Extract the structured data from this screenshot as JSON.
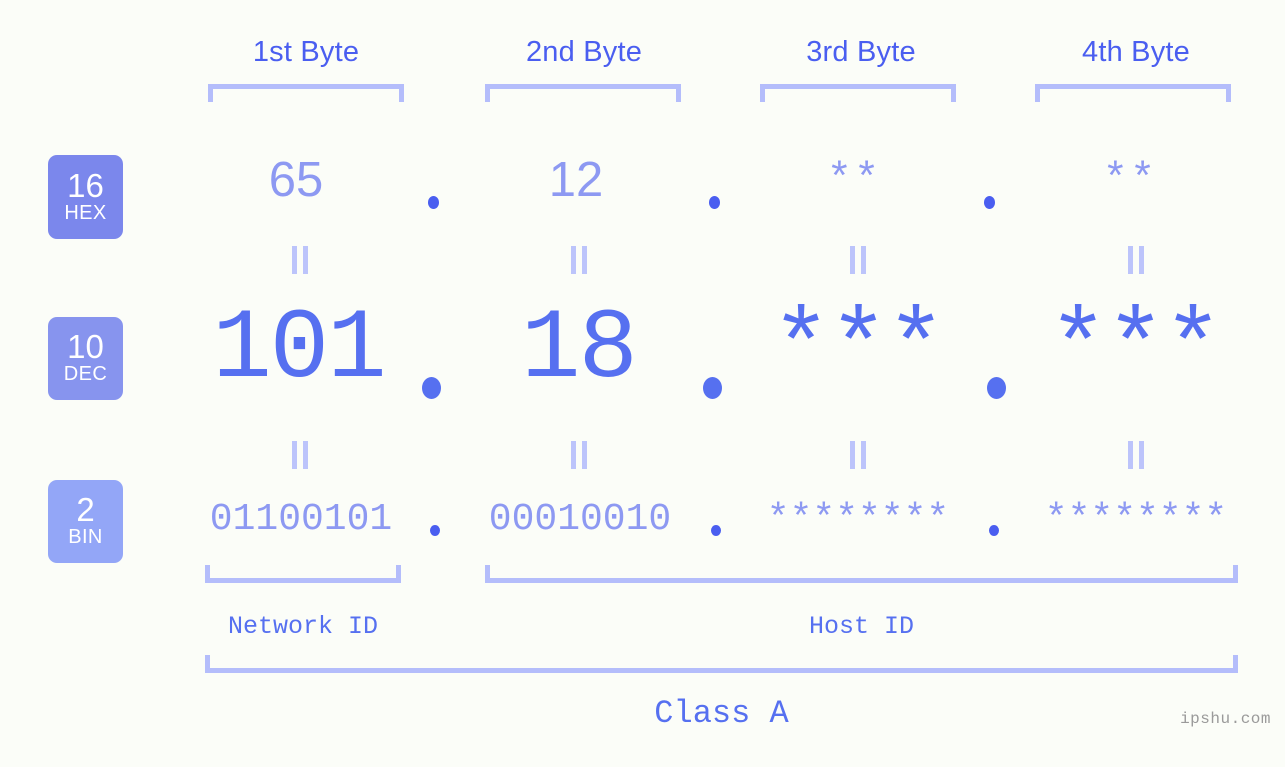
{
  "site": {
    "watermark": "ipshu.com"
  },
  "byte_headers": [
    {
      "label": "1st Byte"
    },
    {
      "label": "2nd Byte"
    },
    {
      "label": "3rd Byte"
    },
    {
      "label": "4th Byte"
    }
  ],
  "bases": [
    {
      "radix": "16",
      "name": "HEX",
      "color": "#7b87ec"
    },
    {
      "radix": "10",
      "name": "DEC",
      "color": "#8794ee"
    },
    {
      "radix": "2",
      "name": "BIN",
      "color": "#93a6f7"
    }
  ],
  "rows": {
    "hex": {
      "radix": "16",
      "name": "HEX",
      "values": [
        "65",
        "12",
        "**",
        "**"
      ],
      "separator": "."
    },
    "dec": {
      "radix": "10",
      "name": "DEC",
      "values": [
        "101",
        "18",
        "***",
        "***"
      ],
      "separator": "."
    },
    "bin": {
      "radix": "2",
      "name": "BIN",
      "values": [
        "01100101",
        "00010010",
        "********",
        "********"
      ],
      "separator": "."
    }
  },
  "equals_symbol": "||",
  "segments": {
    "network_id": "Network ID",
    "host_id": "Host ID",
    "class": "Class A"
  },
  "colors": {
    "background": "#fbfdf8",
    "accent_dark": "#4a5ef0",
    "accent_mid": "#5670f0",
    "accent_light": "#8d99f2",
    "bracket": "#b4bdfb",
    "badge_hex": "#7b87ec",
    "badge_dec": "#8794ee",
    "badge_bin": "#93a6f7",
    "watermark": "#9a9a9a"
  }
}
